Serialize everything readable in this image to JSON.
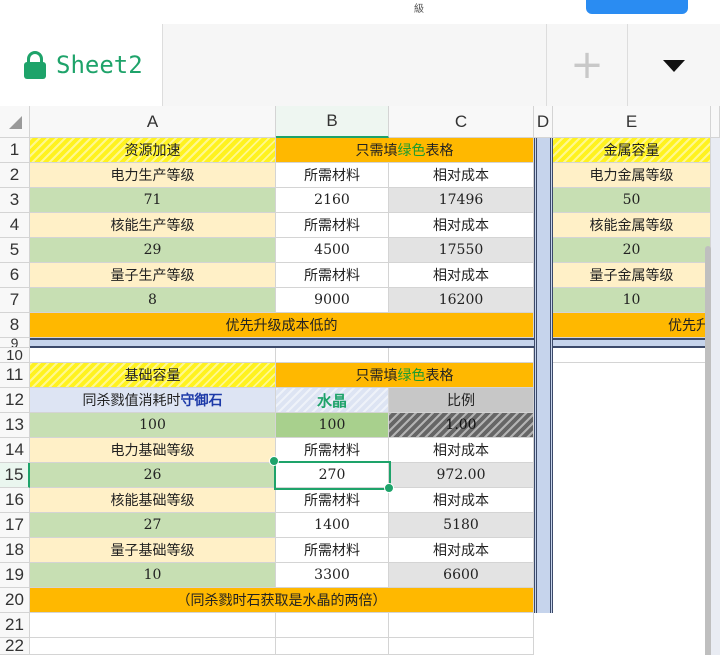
{
  "top": {
    "partial_char": "級"
  },
  "tab": {
    "sheet_name": "Sheet2",
    "add": "+"
  },
  "columns": [
    "A",
    "B",
    "C",
    "D",
    "E"
  ],
  "rows": [
    "1",
    "2",
    "3",
    "4",
    "5",
    "6",
    "7",
    "8",
    "9",
    "10",
    "11",
    "12",
    "13",
    "14",
    "15",
    "16",
    "17",
    "18",
    "19",
    "20",
    "21",
    "22"
  ],
  "cells": {
    "a1": "资源加速",
    "b1_pre": "只需填",
    "b1_green": "绿色",
    "b1_post": "表格",
    "e1": "金属容量",
    "a2": "电力生产等级",
    "b2": "所需材料",
    "c2": "相对成本",
    "e2": "电力金属等级",
    "a3": "71",
    "b3": "2160",
    "c3": "17496",
    "e3": "50",
    "a4": "核能生产等级",
    "b4": "所需材料",
    "c4": "相对成本",
    "e4": "核能金属等级",
    "a5": "29",
    "b5": "4500",
    "c5": "17550",
    "e5": "20",
    "a6": "量子生产等级",
    "b6": "所需材料",
    "c6": "相对成本",
    "e6": "量子金属等级",
    "a7": "8",
    "b7": "9000",
    "c7": "16200",
    "e7": "10",
    "a8": "优先升级成本低的",
    "e8": "优先升",
    "a11": "基础容量",
    "b11_pre": "只需填",
    "b11_green": "绿色",
    "b11_post": "表格",
    "a12_pre": "同杀戮值消耗时",
    "a12_blue": "守御石",
    "b12": "水晶",
    "c12": "比例",
    "a13": "100",
    "b13": "100",
    "c13": "1.00",
    "a14": "电力基础等级",
    "b14": "所需材料",
    "c14": "相对成本",
    "a15": "26",
    "b15": "270",
    "c15": "972.00",
    "a16": "核能基础等级",
    "b16": "所需材料",
    "c16": "相对成本",
    "a17": "27",
    "b17": "1400",
    "c17": "5180",
    "a18": "量子基础等级",
    "b18": "所需材料",
    "c18": "相对成本",
    "a19": "10",
    "b19": "3300",
    "c19": "6600",
    "a20": "（同杀戮时石获取是水晶的两倍）"
  },
  "colors": {
    "accent": "#1ea36a",
    "yellow": "#fff21f",
    "orange": "#ffb800",
    "cream": "#fff0c7",
    "green": "#c7dfb3"
  }
}
